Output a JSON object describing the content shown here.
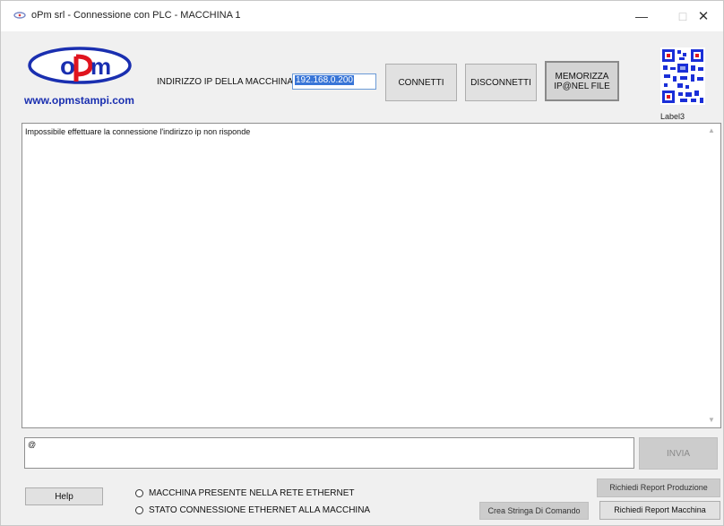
{
  "window": {
    "title": "oPm srl - Connessione con PLC - MACCHINA 1",
    "minimize": "—",
    "maximize": "□",
    "close": "✕"
  },
  "logo": {
    "text": "opm",
    "url": "www.opmstampi.com",
    "color": "#1a2fb0",
    "accent": "#e0141e"
  },
  "connection": {
    "ip_label": "INDIRIZZO IP DELLA MACCHINA 1",
    "ip_value": "192.168.0.200",
    "connect_label": "CONNETTI",
    "disconnect_label": "DISCONNETTI",
    "save_label_line1": "MEMORIZZA",
    "save_label_line2": "IP@NEL FILE"
  },
  "qr": {
    "label": "Label3"
  },
  "log": {
    "message": "Impossibile effettuare la connessione l'indirizzo ip non risponde"
  },
  "command": {
    "value": "@",
    "send_label": "INVIA"
  },
  "footer": {
    "help_label": "Help",
    "status_network": "MACCHINA PRESENTE NELLA RETE ETHERNET",
    "status_connection": "STATO CONNESSIONE ETHERNET ALLA MACCHINA",
    "report_production_label": "Richiedi Report Produzione",
    "create_command_label": "Crea Stringa Di Comando",
    "report_machine_label": "Richiedi Report Macchina"
  }
}
